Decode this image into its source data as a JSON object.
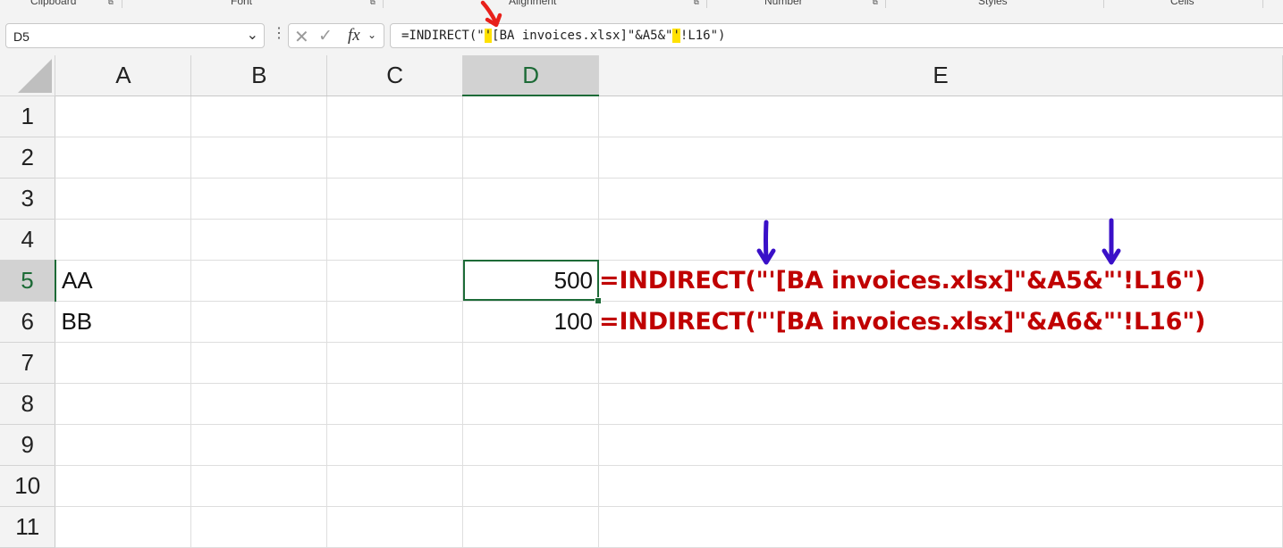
{
  "ribbon": {
    "groups": [
      {
        "label": "Clipboard"
      },
      {
        "label": "Font"
      },
      {
        "label": "Alignment"
      },
      {
        "label": "Number"
      },
      {
        "label": "Styles"
      },
      {
        "label": "Cells"
      }
    ]
  },
  "formula_bar": {
    "name_box": "D5",
    "fx_label": "fx",
    "formula_part1": "=INDIRECT(\"",
    "formula_quote1": "'",
    "formula_part2": "[BA invoices.xlsx]\"&A5&\"",
    "formula_quote2": "'",
    "formula_part3": "!L16\")"
  },
  "sheet": {
    "columns": [
      "A",
      "B",
      "C",
      "D",
      "E"
    ],
    "selected_column": "D",
    "selected_row": "5",
    "rows": [
      {
        "num": "1",
        "A": "",
        "D": "",
        "E": ""
      },
      {
        "num": "2",
        "A": "",
        "D": "",
        "E": ""
      },
      {
        "num": "3",
        "A": "",
        "D": "",
        "E": ""
      },
      {
        "num": "4",
        "A": "",
        "D": "",
        "E": ""
      },
      {
        "num": "5",
        "A": "AA",
        "D": "500",
        "E": "=INDIRECT(\"'[BA invoices.xlsx]\"&A5&\"'!L16\")"
      },
      {
        "num": "6",
        "A": "BB",
        "D": "100",
        "E": "=INDIRECT(\"'[BA invoices.xlsx]\"&A6&\"'!L16\")"
      },
      {
        "num": "7",
        "A": "",
        "D": "",
        "E": ""
      },
      {
        "num": "8",
        "A": "",
        "D": "",
        "E": ""
      },
      {
        "num": "9",
        "A": "",
        "D": "",
        "E": ""
      },
      {
        "num": "10",
        "A": "",
        "D": "",
        "E": ""
      },
      {
        "num": "11",
        "A": "",
        "D": "",
        "E": ""
      }
    ]
  },
  "colors": {
    "annotation_red": "#c00000",
    "selection_green": "#1d6b37",
    "highlight_yellow": "#ffe100",
    "arrow_red": "#e8201a",
    "arrow_purple": "#3a10c8"
  }
}
